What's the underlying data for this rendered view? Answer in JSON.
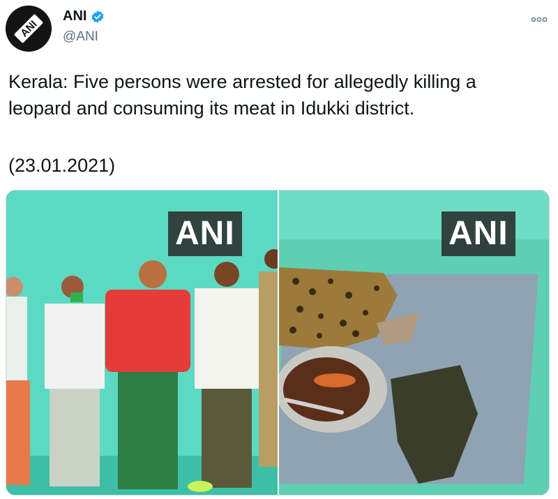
{
  "account": {
    "name": "ANI",
    "handle": "@ANI",
    "avatar_text": "ANI"
  },
  "tweet": {
    "line1": "Kerala: Five persons were arrested for allegedly killing a",
    "line2": "leopard and consuming its meat in Idukki district.",
    "date_line": "(23.01.2021)"
  },
  "media": {
    "left_watermark": "ANI",
    "right_watermark": "ANI"
  },
  "icons": {
    "verified": "verified-badge-icon",
    "more": "more-options-icon"
  },
  "colors": {
    "verified": "#1da1f2",
    "handle": "#5b7083",
    "text": "#0f1419"
  }
}
